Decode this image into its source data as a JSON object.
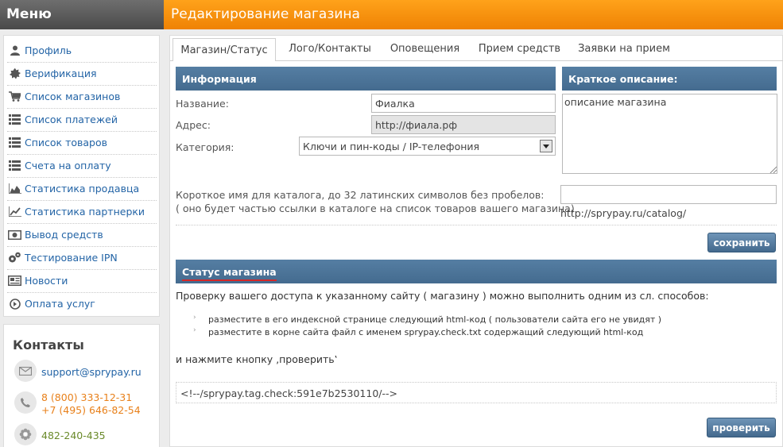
{
  "header": {
    "menu_title": "Меню",
    "page_title": "Редактирование магазина"
  },
  "menu": {
    "items": [
      {
        "label": "Профиль",
        "icon": "user-icon"
      },
      {
        "label": "Верификация",
        "icon": "gear-badge-icon"
      },
      {
        "label": "Список магазинов",
        "icon": "cart-icon"
      },
      {
        "label": "Список платежей",
        "icon": "list-icon"
      },
      {
        "label": "Список товаров",
        "icon": "list-icon"
      },
      {
        "label": "Счета на оплату",
        "icon": "list-icon"
      },
      {
        "label": "Статистика продавца",
        "icon": "area-chart-icon"
      },
      {
        "label": "Статистика партнерки",
        "icon": "line-chart-icon"
      },
      {
        "label": "Вывод средств",
        "icon": "money-icon"
      },
      {
        "label": "Тестирование IPN",
        "icon": "gears-icon"
      },
      {
        "label": "Новости",
        "icon": "newspaper-icon"
      },
      {
        "label": "Оплата услуг",
        "icon": "arrow-circle-icon"
      }
    ]
  },
  "contacts": {
    "title": "Контакты",
    "email": "support@sprypay.ru",
    "phone1": "8 (800) 333-12-31",
    "phone2": "+7 (495) 646-82-54",
    "icq": "482-240-435"
  },
  "tabs": [
    {
      "label": "Магазин/Статус",
      "active": true
    },
    {
      "label": "Лого/Контакты",
      "active": false
    },
    {
      "label": "Оповещения",
      "active": false
    },
    {
      "label": "Прием средств",
      "active": false
    },
    {
      "label": "Заявки на прием",
      "active": false
    }
  ],
  "info": {
    "title": "Информация",
    "name_label": "Название:",
    "name_value": "Фиалка",
    "address_label": "Адрес:",
    "address_value": "http://фиала.рф",
    "category_label": "Категория:",
    "category_value": "Ключи и пин-коды / IP-телефония"
  },
  "desc": {
    "title": "Краткое описание:",
    "value": "описание магазина"
  },
  "catalog": {
    "label_line1": "Короткое имя для каталога, до 32 латинских символов без пробелов:",
    "label_line2": "( оно будет частью ссылки в каталоге на список товаров вашего магазина)",
    "value": "",
    "url_prefix": "http://sprypay.ru/catalog/"
  },
  "save_button": "сохранить",
  "status": {
    "title": "Статус магазина",
    "intro": "Проверку вашего доступа к указанному сайту ( магазину ) можно выполнить одним из сл. способов:",
    "option1": "разместите в его индексной странице следующий html-код ( пользователи сайта его не увидят )",
    "option2": "разместите в корне сайта файл с именем sprypay.check.txt содержащий следующий html-код",
    "press": "и нажмите кнопку ‚проверить‛",
    "code": "<!--/sprypay.tag.check:591e7b2530110/-->",
    "check_button": "проверить"
  },
  "colors": {
    "accent": "#f39212",
    "bar": "#4b7398",
    "link": "#2364a6",
    "phone": "#e8801a",
    "icq": "#6a8a2a"
  }
}
